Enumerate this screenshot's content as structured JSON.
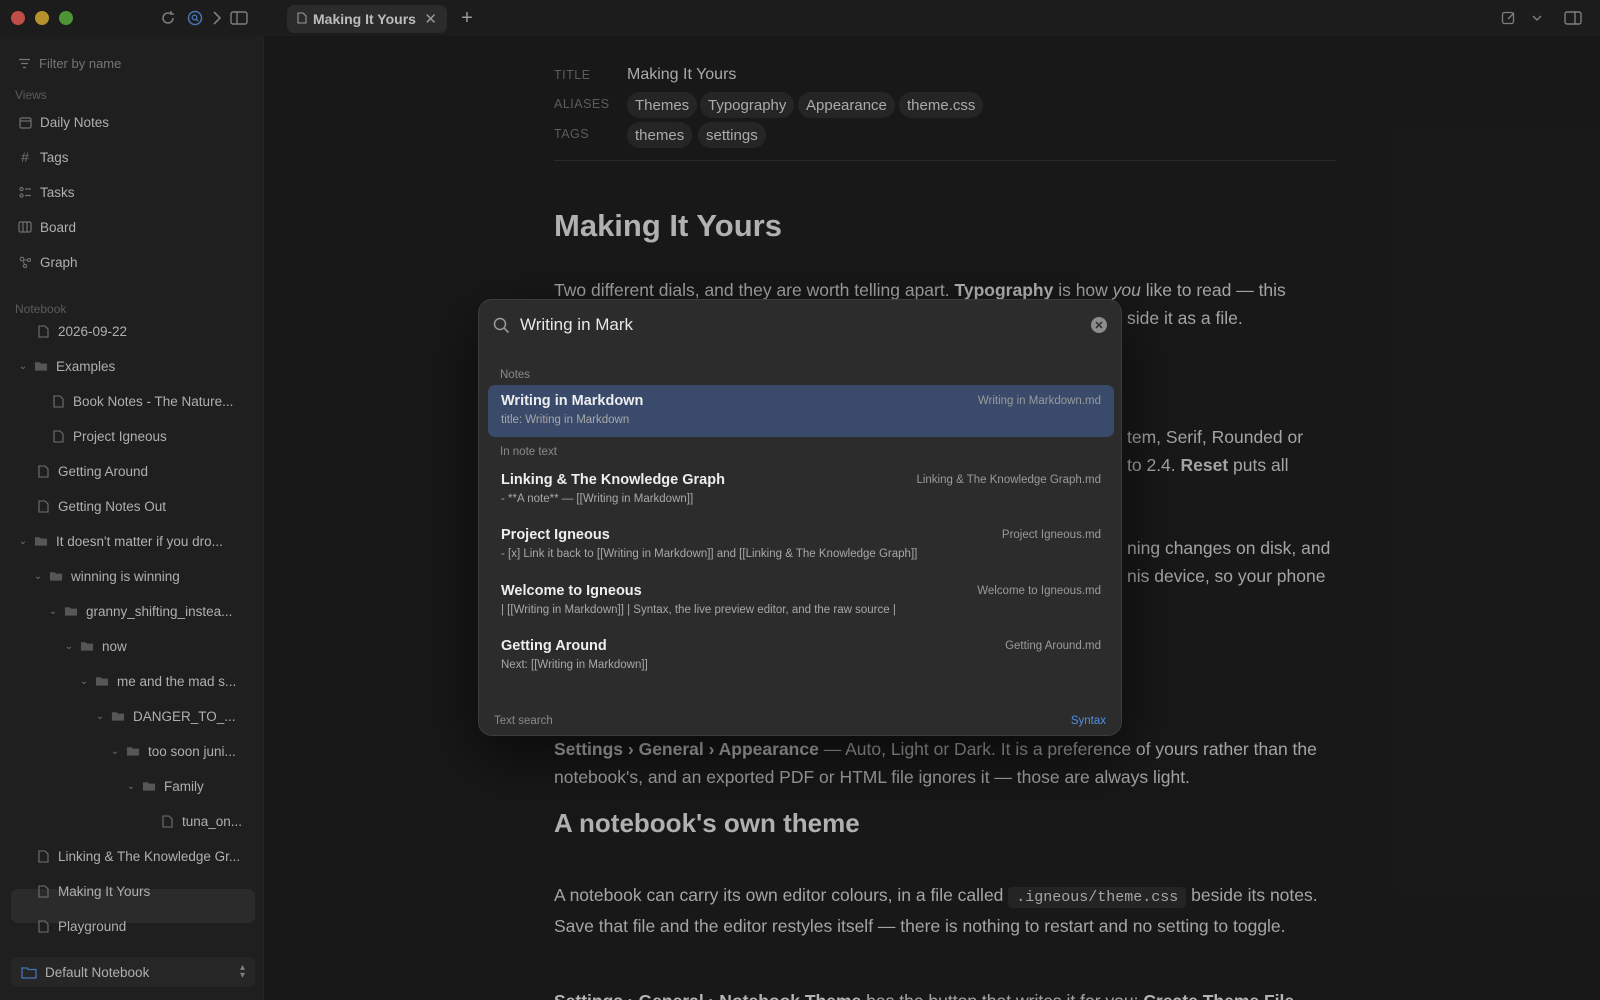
{
  "window": {
    "tab_title": "Making It Yours"
  },
  "sidebar": {
    "filter_placeholder": "Filter by name",
    "views_label": "Views",
    "views": [
      {
        "label": "Daily Notes",
        "icon": "calendar-icon"
      },
      {
        "label": "Tags",
        "icon": "hash-icon"
      },
      {
        "label": "Tasks",
        "icon": "tasks-icon"
      },
      {
        "label": "Board",
        "icon": "board-icon"
      },
      {
        "label": "Graph",
        "icon": "graph-icon"
      }
    ],
    "notebook_label": "Notebook",
    "tree": [
      {
        "label": "2026-09-22",
        "type": "file"
      },
      {
        "label": "Examples",
        "type": "folder"
      },
      {
        "label": "Book Notes - The Nature...",
        "type": "file"
      },
      {
        "label": "Project Igneous",
        "type": "file"
      },
      {
        "label": "Getting Around",
        "type": "file"
      },
      {
        "label": "Getting Notes Out",
        "type": "file"
      },
      {
        "label": "It doesn't matter if you dro...",
        "type": "folder"
      },
      {
        "label": "winning is winning",
        "type": "folder"
      },
      {
        "label": "granny_shifting_instea...",
        "type": "folder"
      },
      {
        "label": "now",
        "type": "folder"
      },
      {
        "label": "me and the mad s...",
        "type": "folder"
      },
      {
        "label": "DANGER_TO_...",
        "type": "folder"
      },
      {
        "label": "too soon juni...",
        "type": "folder"
      },
      {
        "label": "Family",
        "type": "folder"
      },
      {
        "label": "tuna_on...",
        "type": "file"
      },
      {
        "label": "Linking & The Knowledge Gr...",
        "type": "file"
      },
      {
        "label": "Making It Yours",
        "type": "file",
        "selected": true
      },
      {
        "label": "Playground",
        "type": "file"
      }
    ],
    "notebook_switcher": "Default Notebook"
  },
  "editor": {
    "frontmatter": {
      "title_label": "TITLE",
      "title_value": "Making It Yours",
      "aliases_label": "ALIASES",
      "aliases": [
        "Themes",
        "Typography",
        "Appearance",
        "theme.css"
      ],
      "tags_label": "TAGS",
      "tags": [
        "themes",
        "settings"
      ]
    },
    "heading": "Making It Yours",
    "p1_a": "Two different dials, and they are worth telling apart. ",
    "p1_b": "Typography",
    "p1_c": " is how ",
    "p1_d": "you",
    "p1_e": " like to read — this",
    "p1_tail": "side it as a file.",
    "peek_1": "tem, Serif, Rounded or",
    "peek_2a": "to 2.4. ",
    "peek_2b": "Reset",
    "peek_2c": " puts all",
    "peek_3": "ning changes on disk, and",
    "peek_4": "nis device, so your phone",
    "p3_a": "Settings › General › Appearance",
    "p3_b": " — Auto, Light or Dark. It is a preference of yours rather than the notebook's, and an exported PDF or HTML file ignores it — those are always light.",
    "h2": "A notebook's own theme",
    "p4_a": "A notebook can carry its own editor colours, in a file called ",
    "p4_code": ".igneous/theme.css",
    "p4_b": " beside its notes. Save that file and the editor restyles itself — there is nothing to restart and no setting to toggle.",
    "p5_a": "Settings › General › Notebook Theme",
    "p5_b": " has the button that writes it for you: ",
    "p5_c": "Create Theme File"
  },
  "search": {
    "query": "Writing in Mark",
    "notes_label": "Notes",
    "in_note_label": "In note text",
    "results": [
      {
        "title": "Writing in Markdown",
        "snippet": "title: Writing in Markdown",
        "file": "Writing in Markdown.md"
      },
      {
        "title": "Linking & The Knowledge Graph",
        "snippet": "- **A note** — [[Writing in Markdown]]",
        "file": "Linking & The Knowledge Graph.md"
      },
      {
        "title": "Project Igneous",
        "snippet": "- [x] Link it back to [[Writing in Markdown]] and [[Linking & The Knowledge Graph]]",
        "file": "Project Igneous.md"
      },
      {
        "title": "Welcome to Igneous",
        "snippet": "| [[Writing in Markdown]] | Syntax, the live preview editor, and the raw source |",
        "file": "Welcome to Igneous.md"
      },
      {
        "title": "Getting Around",
        "snippet": "Next: [[Writing in Markdown]]",
        "file": "Getting Around.md"
      }
    ],
    "footer_left": "Text search",
    "footer_right": "Syntax"
  },
  "colors": {
    "accent": "#4f8fe6",
    "selection": "#3a4a6b"
  }
}
